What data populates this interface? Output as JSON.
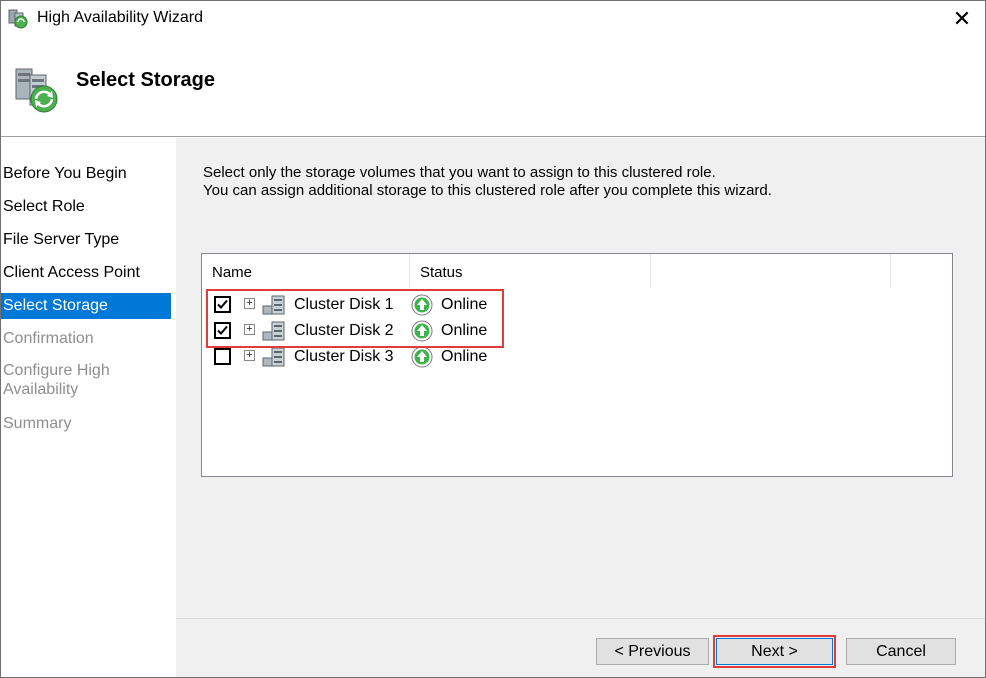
{
  "window": {
    "title": "High Availability Wizard",
    "close_symbol": "✕"
  },
  "header": {
    "title": "Select Storage",
    "icon": "cluster-wizard-icon"
  },
  "nav": {
    "items": [
      {
        "label": "Before You Begin",
        "state": "normal"
      },
      {
        "label": "Select Role",
        "state": "normal"
      },
      {
        "label": "File Server Type",
        "state": "normal"
      },
      {
        "label": "Client Access Point",
        "state": "normal"
      },
      {
        "label": "Select Storage",
        "state": "selected"
      },
      {
        "label": "Confirmation",
        "state": "disabled"
      },
      {
        "label": "Configure High Availability",
        "state": "disabled"
      },
      {
        "label": "Summary",
        "state": "disabled"
      }
    ]
  },
  "content": {
    "description_line1": "Select only the storage volumes that you want to assign to this clustered role.",
    "description_line2": "You can assign additional storage to this clustered role after you complete this wizard."
  },
  "list": {
    "columns": [
      "Name",
      "Status",
      "",
      ""
    ],
    "rows": [
      {
        "name": "Cluster Disk 1",
        "status": "Online",
        "checked": true
      },
      {
        "name": "Cluster Disk 2",
        "status": "Online",
        "checked": true
      },
      {
        "name": "Cluster Disk 3",
        "status": "Online",
        "checked": false
      }
    ]
  },
  "buttons": {
    "previous": "< Previous",
    "next": "Next >",
    "cancel": "Cancel"
  },
  "colors": {
    "accent": "#0078d7",
    "highlight": "#e03c3c",
    "online": "#3cb44b"
  }
}
